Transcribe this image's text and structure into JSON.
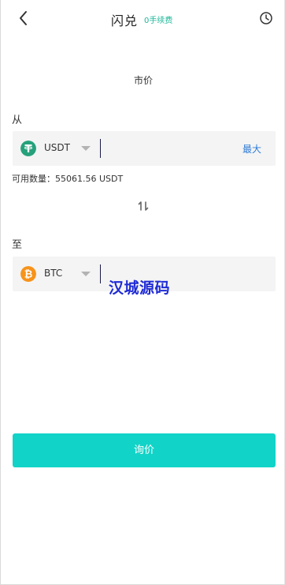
{
  "header": {
    "title": "闪兑",
    "fee_tag": "0手续费"
  },
  "order_type": "市价",
  "from": {
    "label": "从",
    "coin": "USDT",
    "coin_color": "#26a17b",
    "amount_value": "",
    "max_label": "最大",
    "available_text": "可用数量：55061.56 USDT"
  },
  "to": {
    "label": "至",
    "coin": "BTC",
    "coin_color": "#f7931a",
    "amount_value": ""
  },
  "watermark": "汉城源码",
  "submit_label": "询价",
  "icons": {
    "back": "back-arrow-icon",
    "history": "clock-icon",
    "swap": "swap-vertical-icon",
    "usdt": "tether-icon",
    "btc": "bitcoin-icon"
  }
}
